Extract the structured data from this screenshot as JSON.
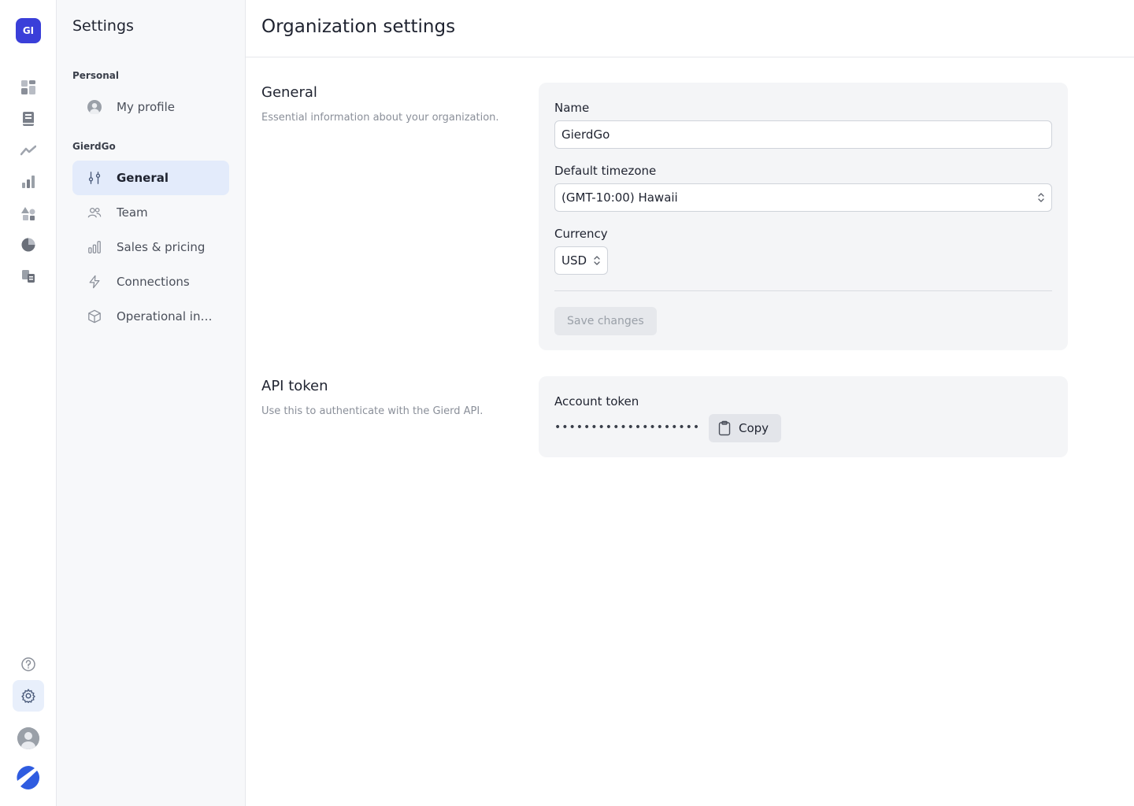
{
  "rail": {
    "org_initials": "GI",
    "icons": [
      "dashboard-icon",
      "book-icon",
      "trend-icon",
      "bar-chart-icon",
      "shapes-icon",
      "pie-chart-icon",
      "transfer-icon",
      "help-icon",
      "settings-icon"
    ]
  },
  "sidebar": {
    "title": "Settings",
    "groups": [
      {
        "label": "Personal"
      },
      {
        "label": "GierdGo"
      }
    ],
    "items": [
      {
        "label": "My profile",
        "icon": "avatar-icon"
      },
      {
        "label": "General",
        "icon": "sliders-icon",
        "active": true
      },
      {
        "label": "Team",
        "icon": "users-icon"
      },
      {
        "label": "Sales & pricing",
        "icon": "bar-chart-icon"
      },
      {
        "label": "Connections",
        "icon": "bolt-icon"
      },
      {
        "label": "Operational int...",
        "icon": "cube-icon"
      }
    ]
  },
  "main": {
    "title": "Organization settings",
    "general": {
      "title": "General",
      "description": "Essential information about your organization.",
      "name_label": "Name",
      "name_value": "GierdGo",
      "timezone_label": "Default timezone",
      "timezone_value": "(GMT-10:00) Hawaii",
      "currency_label": "Currency",
      "currency_value": "USD",
      "save_label": "Save changes"
    },
    "api": {
      "title": "API token",
      "description": "Use this to authenticate with the Gierd API.",
      "token_label": "Account token",
      "token_masked": "••••••••••••••••••••",
      "copy_label": "Copy"
    }
  },
  "colors": {
    "accent": "#3a3fd9",
    "active_bg": "#e3ebfb",
    "card_bg": "#f4f5f7"
  }
}
